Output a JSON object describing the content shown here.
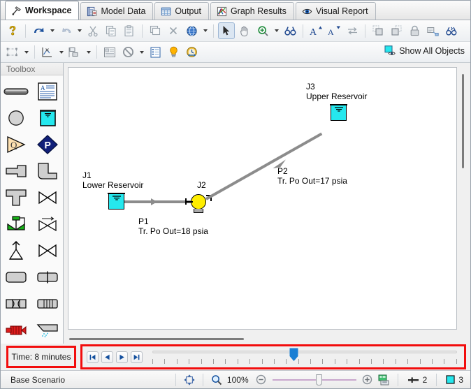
{
  "tabs": [
    {
      "label": "Workspace",
      "icon": "hammer-icon",
      "active": true
    },
    {
      "label": "Model Data",
      "icon": "model-data-icon",
      "active": false
    },
    {
      "label": "Output",
      "icon": "table-icon",
      "active": false
    },
    {
      "label": "Graph Results",
      "icon": "graph-icon",
      "active": false
    },
    {
      "label": "Visual Report",
      "icon": "eye-icon",
      "active": false
    }
  ],
  "toolbar1": [
    {
      "name": "help-icon",
      "label": "Help"
    },
    {
      "name": "undo-icon",
      "label": "Undo"
    },
    {
      "name": "undo-dropdown-caret",
      "label": "Undo history"
    },
    {
      "name": "redo-icon",
      "label": "Redo"
    },
    {
      "name": "redo-dropdown-caret",
      "label": "Redo history"
    },
    {
      "name": "cut-icon",
      "label": "Cut"
    },
    {
      "name": "copy-icon",
      "label": "Copy"
    },
    {
      "name": "paste-icon",
      "label": "Paste"
    },
    {
      "name": "duplicate-icon",
      "label": "Duplicate"
    },
    {
      "name": "delete-icon",
      "label": "Delete"
    },
    {
      "name": "globe-icon",
      "label": "Global Edit"
    },
    {
      "name": "globe-dropdown-caret",
      "label": "Global Edit options"
    },
    {
      "name": "pointer-icon",
      "label": "Select Tool"
    },
    {
      "name": "pan-hand-icon",
      "label": "Pan Tool"
    },
    {
      "name": "zoom-icon",
      "label": "Zoom"
    },
    {
      "name": "zoom-dropdown-caret",
      "label": "Zoom options"
    },
    {
      "name": "find-icon",
      "label": "Find"
    },
    {
      "name": "font-increase-icon",
      "label": "Increase Font"
    },
    {
      "name": "font-decrease-icon",
      "label": "Decrease Font"
    },
    {
      "name": "reverse-direction-icon",
      "label": "Reverse Direction"
    },
    {
      "name": "bring-to-front-icon",
      "label": "Bring to Front"
    },
    {
      "name": "send-to-back-icon",
      "label": "Send to Back"
    },
    {
      "name": "lock-icon",
      "label": "Lock Objects"
    },
    {
      "name": "annotation-icon",
      "label": "Annotation"
    },
    {
      "name": "find-objects-icon",
      "label": "Find Objects"
    }
  ],
  "toolbar2": [
    {
      "name": "select-group-icon",
      "label": "Select Group"
    },
    {
      "name": "select-group-caret",
      "label": "Select Group options"
    },
    {
      "name": "workspace-layers-icon",
      "label": "Workspace Layers"
    },
    {
      "name": "workspace-layers-caret",
      "label": "Workspace Layers options"
    },
    {
      "name": "align-icon",
      "label": "Align Objects"
    },
    {
      "name": "align-caret",
      "label": "Align options"
    },
    {
      "name": "notes-icon",
      "label": "Notes"
    },
    {
      "name": "disable-icon",
      "label": "Special Conditions"
    },
    {
      "name": "disable-caret",
      "label": "Special Conditions options"
    },
    {
      "name": "list-icon",
      "label": "Object Status"
    },
    {
      "name": "bulb-icon",
      "label": "Checklist"
    },
    {
      "name": "transient-icon",
      "label": "Transient Control"
    }
  ],
  "show_all_objects": {
    "label": "Show All Objects",
    "icon": "show-objects-icon"
  },
  "toolbox": {
    "title": "Toolbox",
    "items": [
      {
        "name": "pipe-tool",
        "label": "Pipe"
      },
      {
        "name": "annotation-tool",
        "label": "Annotation"
      },
      {
        "name": "branch-junction",
        "label": "Branch"
      },
      {
        "name": "reservoir-junction",
        "label": "Reservoir"
      },
      {
        "name": "assigned-flow-junction",
        "label": "Assigned Flow"
      },
      {
        "name": "assigned-pressure-junction",
        "label": "Assigned Pressure"
      },
      {
        "name": "dead-end-junction",
        "label": "Dead End"
      },
      {
        "name": "bend-junction",
        "label": "Bend"
      },
      {
        "name": "tee-junction",
        "label": "Tee / Wye"
      },
      {
        "name": "valve-junction",
        "label": "Valve"
      },
      {
        "name": "control-valve-junction",
        "label": "Control Valve"
      },
      {
        "name": "check-valve-junction",
        "label": "Check Valve"
      },
      {
        "name": "spray-discharge-junction",
        "label": "Spray Discharge"
      },
      {
        "name": "relief-valve-junction",
        "label": "Relief Valve"
      },
      {
        "name": "venturi-junction",
        "label": "Venturi"
      },
      {
        "name": "heat-exchanger-junction",
        "label": "Heat Exchanger"
      },
      {
        "name": "orifice-junction",
        "label": "Orifice"
      },
      {
        "name": "screen-junction",
        "label": "Screen"
      },
      {
        "name": "general-component-junction",
        "label": "General Component"
      },
      {
        "name": "area-change-junction",
        "label": "Area Change"
      },
      {
        "name": "pump-junction",
        "label": "Pump"
      },
      {
        "name": "reducing-valve-junction",
        "label": "Reducing Valve"
      }
    ]
  },
  "workspace": {
    "junctions": [
      {
        "id": "J1",
        "name": "Lower Reservoir",
        "type": "reservoir"
      },
      {
        "id": "J2",
        "name": "",
        "type": "pump"
      },
      {
        "id": "J3",
        "name": "Upper Reservoir",
        "type": "reservoir"
      }
    ],
    "pipes": [
      {
        "id": "P1",
        "result": "Tr. Po Out=18 psia"
      },
      {
        "id": "P2",
        "result": "Tr. Po Out=17 psia"
      }
    ]
  },
  "playback": {
    "time_label": "Time: 8 minutes",
    "buttons": [
      {
        "name": "jump-to-start-button",
        "glyph": "first"
      },
      {
        "name": "step-back-button",
        "glyph": "prev"
      },
      {
        "name": "step-forward-button",
        "glyph": "next"
      },
      {
        "name": "jump-to-end-button",
        "glyph": "last"
      }
    ],
    "slider_position_pct": 46,
    "tick_count": 26,
    "highlight_color": "#f20d0d"
  },
  "status": {
    "scenario": "Base Scenario",
    "fit_icon": "fit-to-window-icon",
    "zoom_icon": "zoom-magnifier-icon",
    "zoom_level": "100%",
    "zoom_out_icon": "zoom-out-icon",
    "zoom_in_icon": "zoom-in-icon",
    "save_view_icon": "save-view-icon",
    "pipe_count_icon": "pipe-count-icon",
    "pipe_count": "2",
    "junction_count_icon": "junction-count-icon",
    "junction_count": "3"
  }
}
